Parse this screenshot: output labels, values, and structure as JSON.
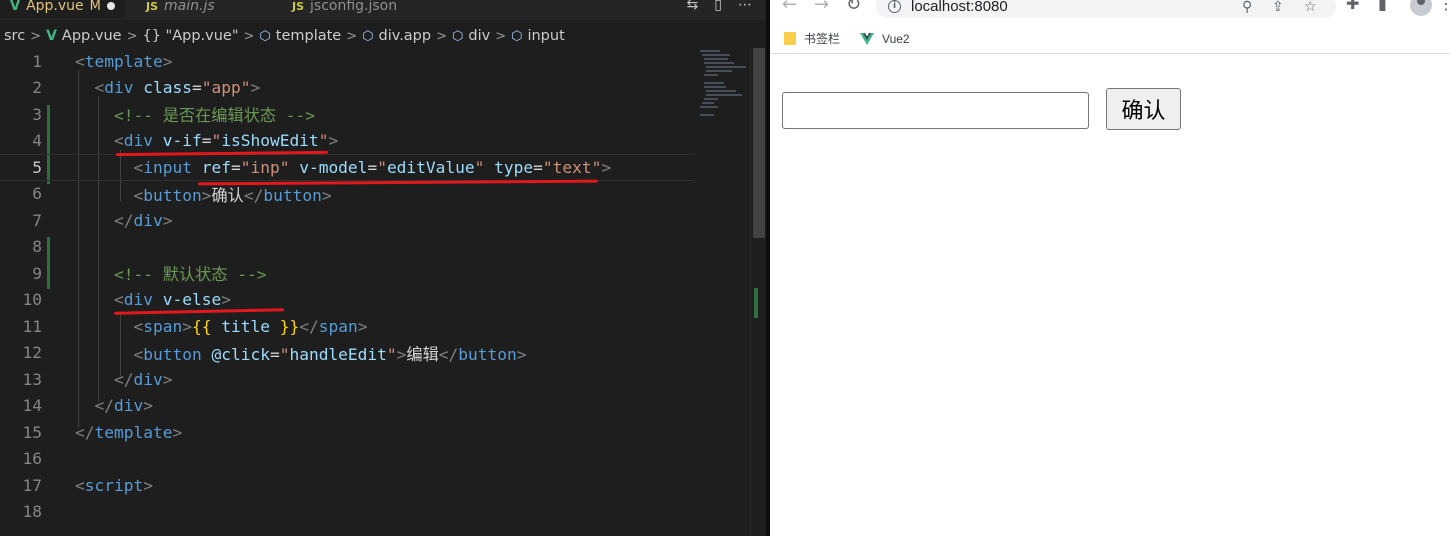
{
  "editor": {
    "tabs": [
      {
        "label": "App.vue",
        "status": "M",
        "active": true
      },
      {
        "label": "main.js"
      },
      {
        "label": "jsconfig.json"
      }
    ],
    "breadcrumb": [
      "src",
      "App.vue",
      "{} \"App.vue\"",
      "template",
      "div.app",
      "div",
      "input"
    ],
    "current_line": 5
  },
  "browser": {
    "url": "localhost:8080",
    "bookmarks": [
      "书签栏",
      "Vue2"
    ],
    "page": {
      "input_value": "",
      "button_label": "确认"
    }
  },
  "colors": {
    "editor_bg": "#1e1e1e",
    "tag": "#569cd6",
    "attr": "#9cdcfe",
    "string": "#ce9178",
    "comment": "#6a9955",
    "annotation_red": "#e2181c",
    "vue_green": "#41b883"
  }
}
